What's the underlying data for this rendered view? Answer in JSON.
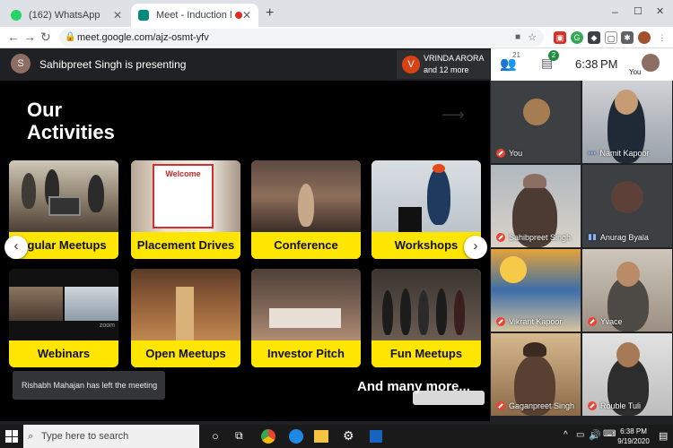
{
  "browser": {
    "tabs": [
      {
        "title": "(162) WhatsApp",
        "active": false
      },
      {
        "title": "Meet - Induction Meetup fo",
        "active": true
      }
    ],
    "new_tab": "+",
    "url": "meet.google.com/ajz-osmt-yfv",
    "controls": {
      "minimize": "–",
      "maximize": "☐",
      "close": "✕"
    }
  },
  "meet": {
    "presenter_text": "Sahibpreet Singh is presenting",
    "presenter_avatar_letter": "S",
    "host": {
      "avatar_letter": "V",
      "name": "VRINDA ARORA",
      "more": "and 12 more"
    },
    "participants_count": "21",
    "chat_count": "2",
    "time": "6:38",
    "time_suffix": "PM",
    "you_label": "You",
    "slide": {
      "title_line1": "Our",
      "title_line2": "Activities",
      "cards_row1": [
        "egular Meetups",
        "Placement Drives",
        "Conference",
        "Workshops"
      ],
      "cards_row2": [
        "Webinars",
        "Open Meetups",
        "Investor Pitch",
        "Fun Meetups"
      ],
      "welcome_sign": "Welcome",
      "zoom_watermark": "zoom",
      "and_many_more": "And many more..."
    },
    "notification": "Rishabh Mahajan has left the meeting",
    "tiles": [
      {
        "name": "You",
        "muted": true
      },
      {
        "name": "Namit Kapoor",
        "muted": false
      },
      {
        "name": "Sahibpreet Singh",
        "muted": true
      },
      {
        "name": "Anurag Byala",
        "muted": false
      },
      {
        "name": "Vikrant Kapoor",
        "muted": true
      },
      {
        "name": "Yvace",
        "muted": true
      },
      {
        "name": "Gaganpreet Singh",
        "muted": true
      },
      {
        "name": "Rouble Tuli",
        "muted": true
      }
    ]
  },
  "taskbar": {
    "search_placeholder": "Type here to search",
    "clock_time": "6:38 PM",
    "clock_date": "9/19/2020"
  }
}
